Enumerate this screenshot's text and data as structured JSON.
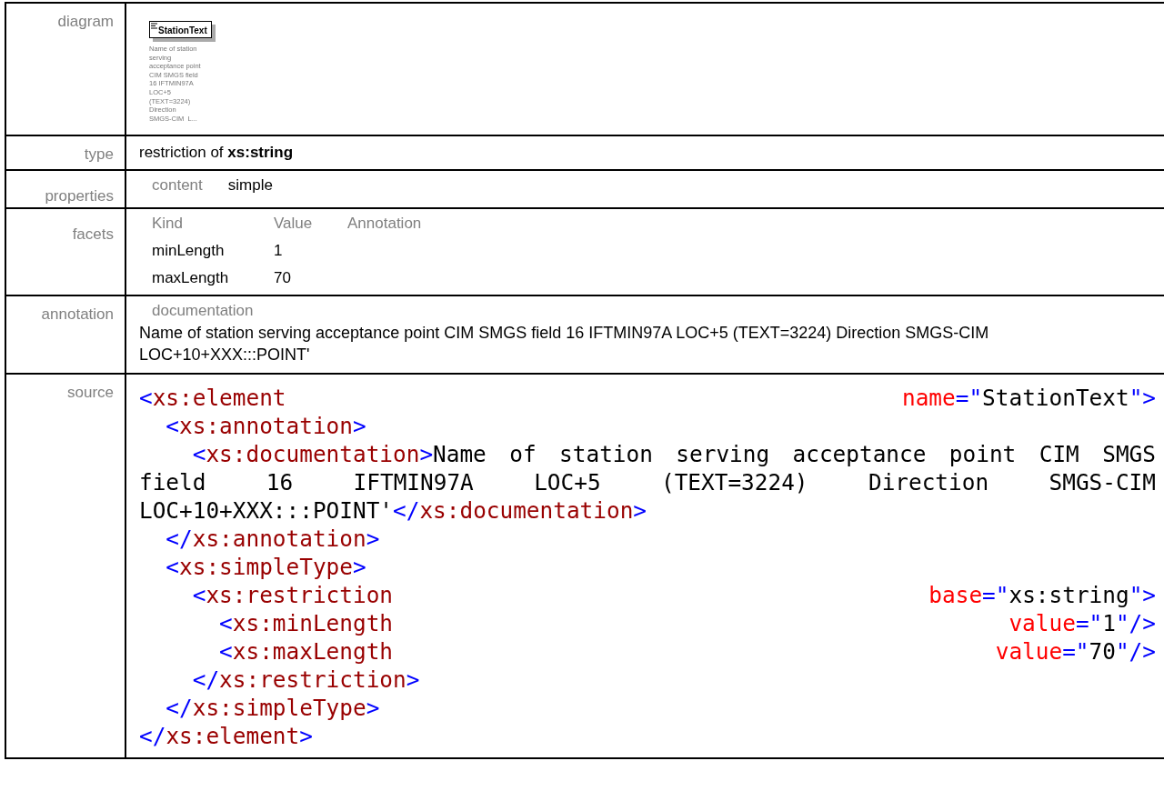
{
  "rows": [
    {
      "kind": "diagram",
      "label": "diagram",
      "element": "StationText",
      "caption": [
        "Name of station",
        "serving",
        "acceptance point",
        "CIM SMGS field",
        "16 IFTMIN97A",
        "LOC+5",
        "(TEXT=3224)",
        "Direction",
        "SMGS-CIM  L..."
      ]
    },
    {
      "kind": "type",
      "label": "type",
      "text": "restriction of **xs:string**"
    },
    {
      "kind": "properties",
      "label": "properties",
      "items": [
        {
          "name": "content",
          "value": "simple"
        }
      ]
    },
    {
      "kind": "facets",
      "label": "facets",
      "columns": [
        "Kind",
        "Value",
        "Annotation"
      ],
      "facets": [
        {
          "kind": "minLength",
          "value": "1"
        },
        {
          "kind": "maxLength",
          "value": "70"
        }
      ]
    },
    {
      "kind": "annotation",
      "label": "annotation",
      "heading": "documentation",
      "text": "Name of station serving acceptance point CIM SMGS field 16 IFTMIN97A LOC+5 (TEXT=3224) Direction SMGS-CIM LOC+10+XXX:::POINT'"
    },
    {
      "kind": "source",
      "label": "source",
      "lines": [
        [
          {
            "punct": "<"
          },
          {
            "tag": "xs:element"
          },
          {
            "attr": "name"
          },
          {
            "punct": "=\""
          },
          {
            "value": "StationText"
          },
          {
            "punct": "\">"
          }
        ],
        [
          {
            "punct": "  <"
          },
          {
            "tag": "xs:annotation"
          },
          {
            "punct": ">"
          }
        ],
        [
          {
            "punct": "    <"
          },
          {
            "tag": "xs:documentation"
          },
          {
            "punct": ">"
          },
          {
            "value": "Name of station serving acceptance point CIM SMGS field 16 IFTMIN97A LOC+5 (TEXT=3224) Direction SMGS-CIM LOC+10+XXX:::POINT'"
          },
          {
            "punct": "</"
          },
          {
            "tag": "xs:documentation"
          },
          {
            "punct": ">"
          }
        ],
        [
          {
            "punct": "  </"
          },
          {
            "tag": "xs:annotation"
          },
          {
            "punct": ">"
          }
        ],
        [
          {
            "punct": "  <"
          },
          {
            "tag": "xs:simpleType"
          },
          {
            "punct": ">"
          }
        ],
        [
          {
            "punct": "    <"
          },
          {
            "tag": "xs:restriction"
          },
          {
            "attr": "base"
          },
          {
            "punct": "=\""
          },
          {
            "value": "xs:string"
          },
          {
            "punct": "\">"
          }
        ],
        [
          {
            "punct": "      <"
          },
          {
            "tag": "xs:minLength"
          },
          {
            "attr": "value"
          },
          {
            "punct": "=\""
          },
          {
            "value": "1"
          },
          {
            "punct": "\"/>"
          }
        ],
        [
          {
            "punct": "      <"
          },
          {
            "tag": "xs:maxLength"
          },
          {
            "attr": "value"
          },
          {
            "punct": "=\""
          },
          {
            "value": "70"
          },
          {
            "punct": "\"/>"
          }
        ],
        [
          {
            "punct": "    </"
          },
          {
            "tag": "xs:restriction"
          },
          {
            "punct": ">"
          }
        ],
        [
          {
            "punct": "  </"
          },
          {
            "tag": "xs:simpleType"
          },
          {
            "punct": ">"
          }
        ],
        [
          {
            "punct": "</"
          },
          {
            "tag": "xs:element"
          },
          {
            "punct": ">"
          }
        ]
      ]
    }
  ]
}
